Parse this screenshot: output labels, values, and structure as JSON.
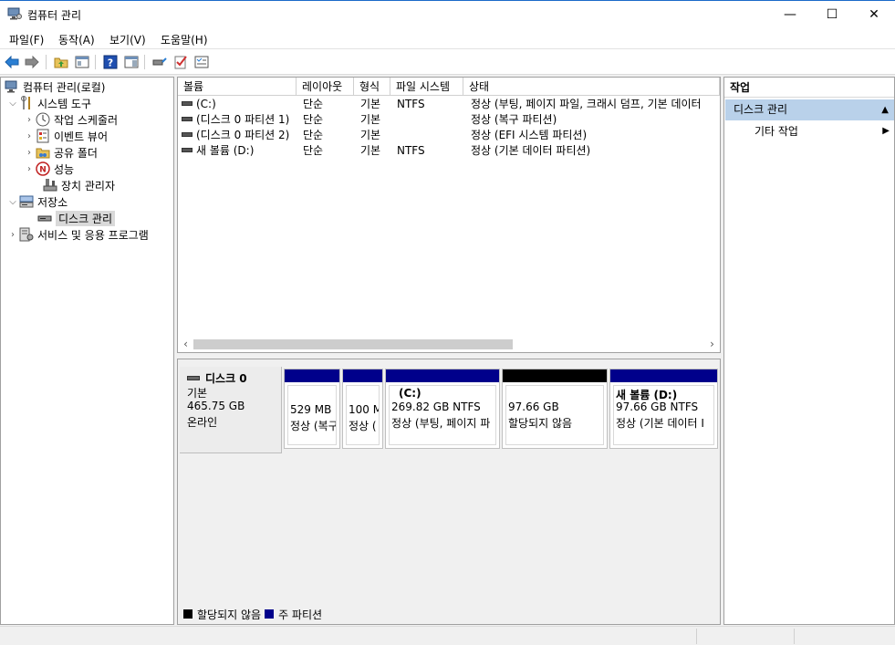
{
  "window": {
    "title": "컴퓨터 관리",
    "minimize": "—",
    "maximize": "☐",
    "close": "✕"
  },
  "menu": [
    "파일(F)",
    "동작(A)",
    "보기(V)",
    "도움말(H)"
  ],
  "tree": {
    "root": "컴퓨터 관리(로컬)",
    "system_tools": "시스템 도구",
    "task_scheduler": "작업 스케줄러",
    "event_viewer": "이벤트 뷰어",
    "shared_folders": "공유 폴더",
    "performance": "성능",
    "device_manager": "장치 관리자",
    "storage": "저장소",
    "disk_management": "디스크 관리",
    "services": "서비스 및 응용 프로그램"
  },
  "volumes": {
    "columns": [
      "볼륨",
      "레이아웃",
      "형식",
      "파일 시스템",
      "상태"
    ],
    "rows": [
      {
        "volume": "(C:)",
        "layout": "단순",
        "type": "기본",
        "fs": "NTFS",
        "status": "정상 (부팅, 페이지 파일, 크래시 덤프, 기본 데이터"
      },
      {
        "volume": "(디스크 0 파티션 1)",
        "layout": "단순",
        "type": "기본",
        "fs": "",
        "status": "정상 (복구 파티션)"
      },
      {
        "volume": "(디스크 0 파티션 2)",
        "layout": "단순",
        "type": "기본",
        "fs": "",
        "status": "정상 (EFI 시스템 파티션)"
      },
      {
        "volume": "새 볼륨 (D:)",
        "layout": "단순",
        "type": "기본",
        "fs": "NTFS",
        "status": "정상 (기본 데이터 파티션)"
      }
    ]
  },
  "disk": {
    "name": "디스크 0",
    "type": "기본",
    "size": "465.75 GB",
    "state": "온라인",
    "partitions": [
      {
        "title": "",
        "line1": "529 MB",
        "line2": "정상 (복구",
        "color": "#00008b"
      },
      {
        "title": "",
        "line1": "100 M",
        "line2": "정상 (",
        "color": "#00008b"
      },
      {
        "title": "(C:)",
        "line1": "269.82 GB NTFS",
        "line2": "정상 (부팅, 페이지 파",
        "color": "#00008b"
      },
      {
        "title": "",
        "line1": "97.66 GB",
        "line2": "할당되지 않음",
        "color": "#000000"
      },
      {
        "title": "새 볼륨  (D:)",
        "line1": "97.66 GB NTFS",
        "line2": "정상 (기본 데이터 I",
        "color": "#00008b"
      }
    ]
  },
  "legend": [
    {
      "label": "할당되지 않음",
      "color": "#000000"
    },
    {
      "label": "주 파티션",
      "color": "#00008b"
    }
  ],
  "actions": {
    "header": "작업",
    "section": "디스크 관리",
    "more": "기타 작업"
  }
}
